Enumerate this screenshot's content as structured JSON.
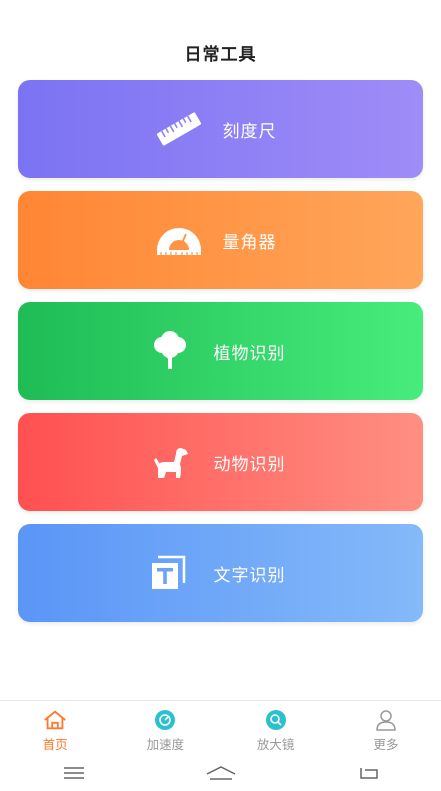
{
  "header": {
    "title": "日常工具"
  },
  "tools": [
    {
      "label": "刻度尺",
      "icon": "ruler-icon"
    },
    {
      "label": "量角器",
      "icon": "protractor-icon"
    },
    {
      "label": "植物识别",
      "icon": "tree-icon"
    },
    {
      "label": "动物识别",
      "icon": "dog-icon"
    },
    {
      "label": "文字识别",
      "icon": "text-scan-icon"
    }
  ],
  "colors": {
    "ruler": [
      "#7b73f3",
      "#9f8cf7"
    ],
    "protractor": [
      "#ff8634",
      "#ffa65a"
    ],
    "plant": [
      "#1fbc55",
      "#48ec7c"
    ],
    "animal": [
      "#ff5050",
      "#ff8f82"
    ],
    "text": [
      "#5b95f7",
      "#84baf9"
    ],
    "nav_active": "#ff7a2b",
    "nav_inactive": "#999999",
    "accent_teal": "#2ac0cf"
  },
  "bottom_nav": {
    "items": [
      {
        "label": "首页",
        "icon": "home-icon",
        "active": true
      },
      {
        "label": "加速度",
        "icon": "speedometer-icon",
        "active": false
      },
      {
        "label": "放大镜",
        "icon": "magnifier-icon",
        "active": false
      },
      {
        "label": "更多",
        "icon": "person-icon",
        "active": false
      }
    ]
  },
  "system_nav": {
    "buttons": [
      "menu-icon",
      "home-icon",
      "back-icon"
    ]
  }
}
